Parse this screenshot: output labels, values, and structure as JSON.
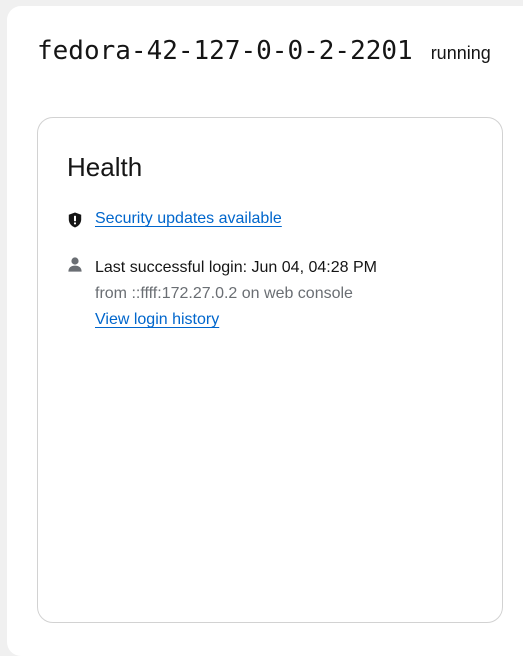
{
  "header": {
    "hostname": "fedora-42-127-0-0-2-2201",
    "state": "running"
  },
  "health_card": {
    "title": "Health",
    "security": {
      "icon": "shield-alert-icon",
      "link_label": "Security updates available"
    },
    "last_login": {
      "icon": "user-icon",
      "summary": "Last successful login: Jun 04, 04:28 PM",
      "origin": "from ::ffff:172.27.0.2 on web console",
      "history_link_label": "View login history"
    }
  },
  "colors": {
    "link": "#0066cc",
    "muted_text": "#6a6e73",
    "card_border": "#d2d2d2",
    "background": "#f0f0f0"
  }
}
